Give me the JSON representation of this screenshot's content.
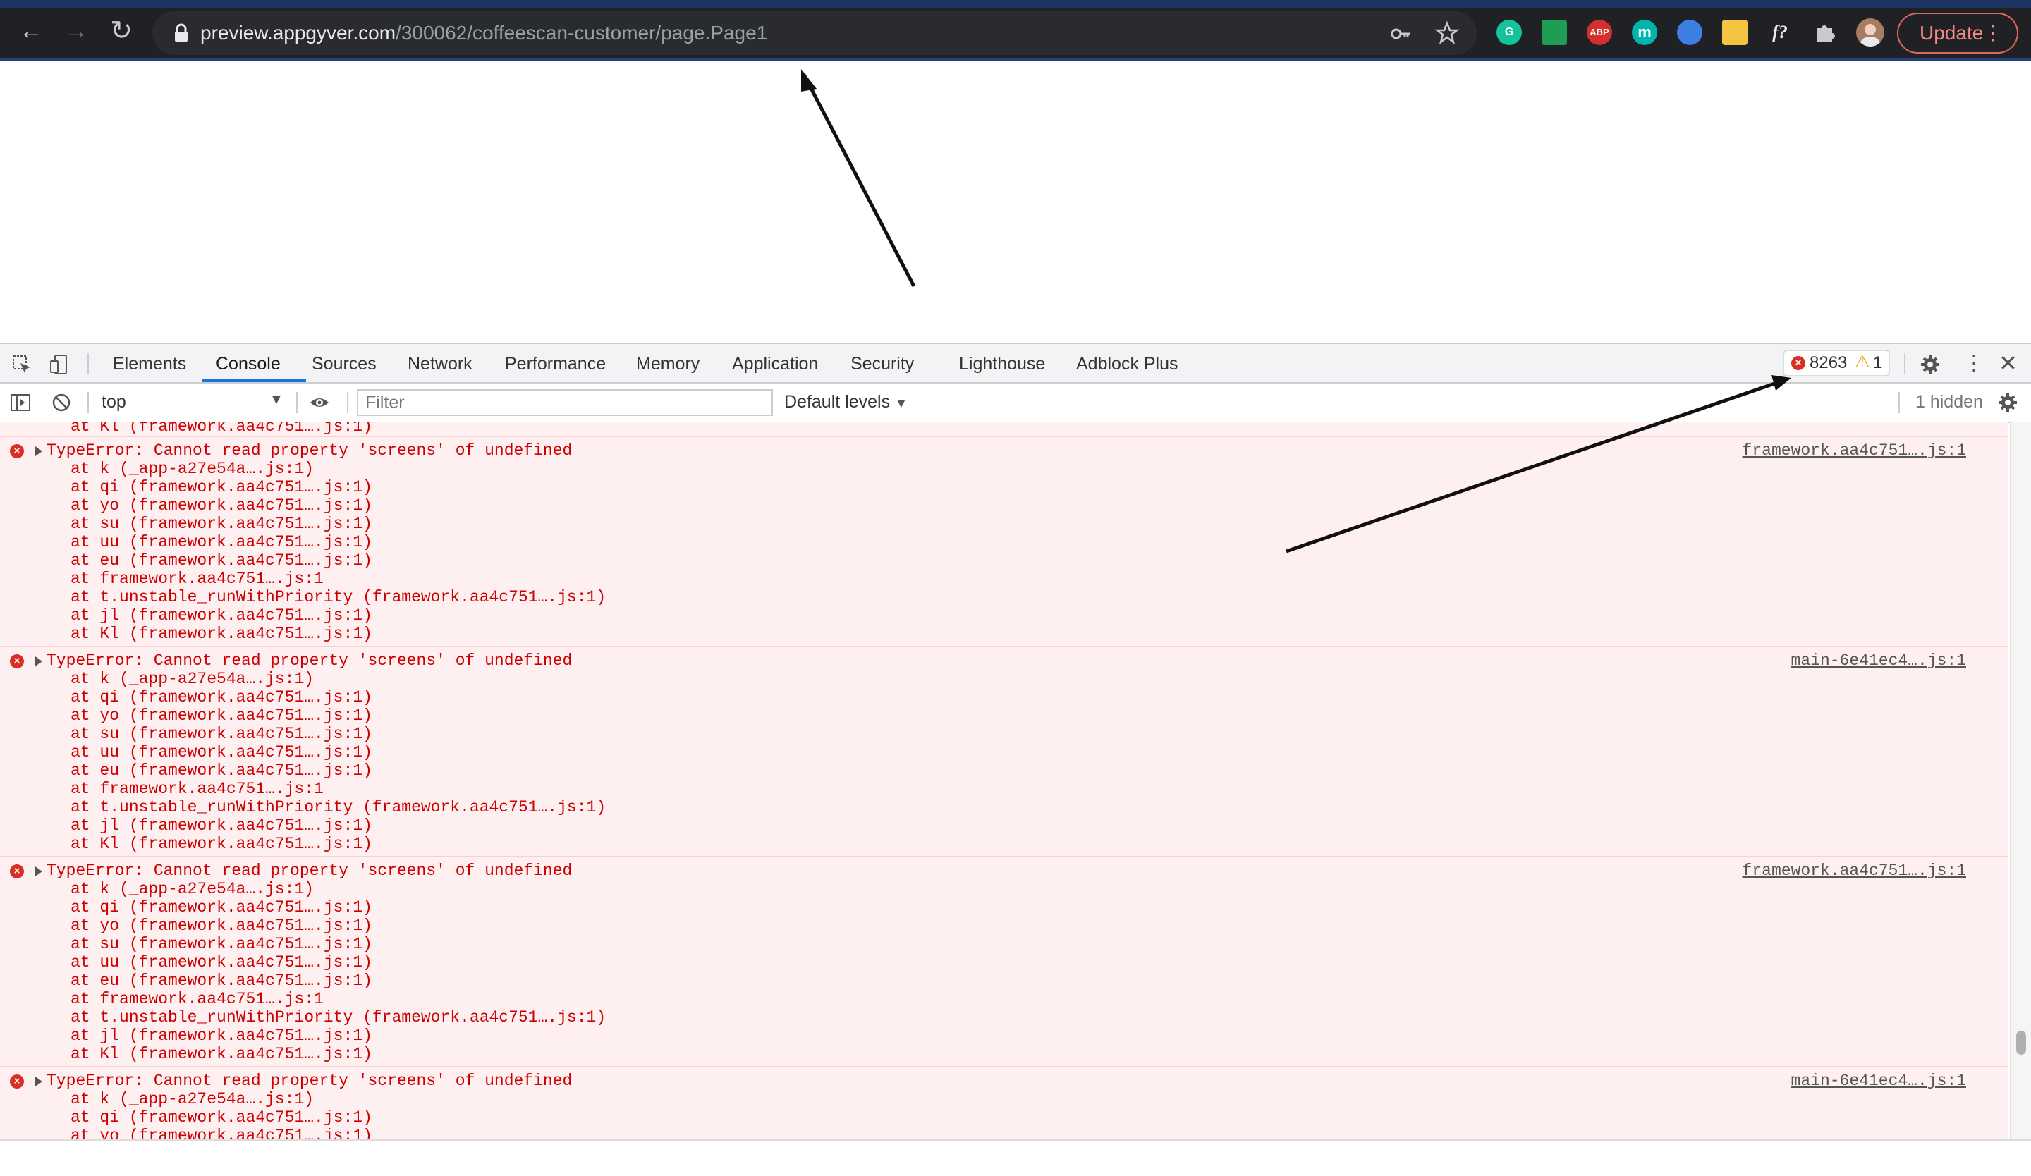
{
  "browser": {
    "url_host": "preview.appgyver.com",
    "url_path": "/300062/coffeescan-customer/page.Page1",
    "update_label": "Update",
    "extensions": [
      {
        "name": "grammarly-extension-icon",
        "label": "G",
        "color": "#15c39a"
      },
      {
        "name": "green-extension-icon",
        "label": "",
        "color": "#1f9d55"
      },
      {
        "name": "adblock-plus-extension-icon",
        "label": "ABP",
        "color": "#d32f2f"
      },
      {
        "name": "m-extension-icon",
        "label": "m",
        "color": "#00b5ad"
      },
      {
        "name": "blue-extension-icon",
        "label": "",
        "color": "#3d7fe3"
      },
      {
        "name": "notes-extension-icon",
        "label": "",
        "color": "#f5c542"
      },
      {
        "name": "function-extension-icon",
        "label": "f?",
        "color": "transparent"
      }
    ]
  },
  "devtools": {
    "tabs": [
      "Elements",
      "Console",
      "Sources",
      "Network",
      "Performance",
      "Memory",
      "Application",
      "Security",
      "Lighthouse",
      "Adblock Plus"
    ],
    "active_tab": "Console",
    "error_count": "8263",
    "warning_count": "1",
    "context": "top",
    "filter_placeholder": "Filter",
    "levels": "Default levels",
    "hidden": "1 hidden"
  },
  "console": {
    "partial_top": "at Kl (framework.aa4c751….js:1)",
    "messages": [
      {
        "text": "TypeError: Cannot read property 'screens' of undefined",
        "source": "framework.aa4c751….js:1",
        "stack": [
          "at k (_app-a27e54a….js:1)",
          "at qi (framework.aa4c751….js:1)",
          "at yo (framework.aa4c751….js:1)",
          "at su (framework.aa4c751….js:1)",
          "at uu (framework.aa4c751….js:1)",
          "at eu (framework.aa4c751….js:1)",
          "at framework.aa4c751….js:1",
          "at t.unstable_runWithPriority (framework.aa4c751….js:1)",
          "at jl (framework.aa4c751….js:1)",
          "at Kl (framework.aa4c751….js:1)"
        ]
      },
      {
        "text": "TypeError: Cannot read property 'screens' of undefined",
        "source": "main-6e41ec4….js:1",
        "stack": [
          "at k (_app-a27e54a….js:1)",
          "at qi (framework.aa4c751….js:1)",
          "at yo (framework.aa4c751….js:1)",
          "at su (framework.aa4c751….js:1)",
          "at uu (framework.aa4c751….js:1)",
          "at eu (framework.aa4c751….js:1)",
          "at framework.aa4c751….js:1",
          "at t.unstable_runWithPriority (framework.aa4c751….js:1)",
          "at jl (framework.aa4c751….js:1)",
          "at Kl (framework.aa4c751….js:1)"
        ]
      },
      {
        "text": "TypeError: Cannot read property 'screens' of undefined",
        "source": "framework.aa4c751….js:1",
        "stack": [
          "at k (_app-a27e54a….js:1)",
          "at qi (framework.aa4c751….js:1)",
          "at yo (framework.aa4c751….js:1)",
          "at su (framework.aa4c751….js:1)",
          "at uu (framework.aa4c751….js:1)",
          "at eu (framework.aa4c751….js:1)",
          "at framework.aa4c751….js:1",
          "at t.unstable_runWithPriority (framework.aa4c751….js:1)",
          "at jl (framework.aa4c751….js:1)",
          "at Kl (framework.aa4c751….js:1)"
        ]
      },
      {
        "text": "TypeError: Cannot read property 'screens' of undefined",
        "source": "main-6e41ec4….js:1",
        "stack": [
          "at k (_app-a27e54a….js:1)",
          "at qi (framework.aa4c751….js:1)",
          "at yo (framework.aa4c751….js:1)"
        ]
      }
    ]
  }
}
